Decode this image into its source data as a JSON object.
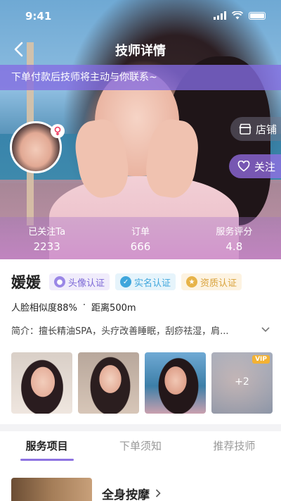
{
  "status_bar": {
    "time": "9:41"
  },
  "nav": {
    "title": "技师详情"
  },
  "notice": {
    "text": "下单付款后技师将主动与你联系~"
  },
  "side_actions": {
    "shop_label": "店铺",
    "follow_label": "关注"
  },
  "stats": [
    {
      "label": "已关注Ta",
      "value": "2233"
    },
    {
      "label": "订单",
      "value": "666"
    },
    {
      "label": "服务评分",
      "value": "4.8"
    }
  ],
  "profile": {
    "name": "媛媛",
    "badges": [
      "头像认证",
      "实名认证",
      "资质认证"
    ],
    "face_similarity": "人脸相似度88%",
    "distance": "距离500m",
    "intro": "简介：擅长精油SPA，头疗改善睡眠，刮痧祛湿，肩..."
  },
  "gallery": {
    "more_count": "+2",
    "vip_label": "VIP"
  },
  "tabs": [
    "服务项目",
    "下单须知",
    "推荐技师"
  ],
  "service": {
    "name": "全身按摩"
  },
  "colors": {
    "accent": "#8d72e1",
    "notice_bg": "#846ce2"
  }
}
